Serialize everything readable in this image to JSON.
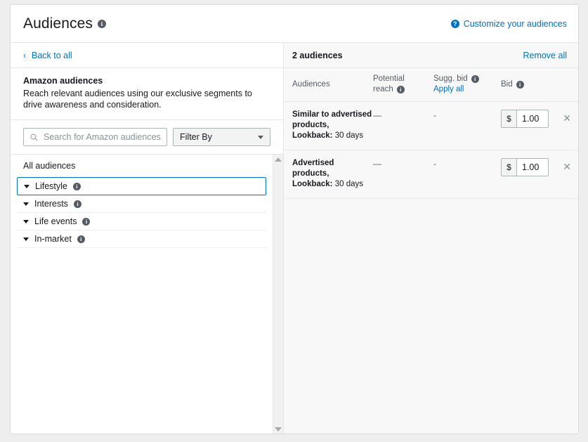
{
  "header": {
    "title": "Audiences",
    "title_info_icon": "info-icon",
    "customize_link": "Customize your audiences",
    "customize_icon": "question-circle-icon"
  },
  "left_panel": {
    "back_link": "Back to all",
    "back_icon": "chevron-left-icon",
    "description_title": "Amazon audiences",
    "description_text": "Reach relevant audiences using our exclusive segments to drive awareness and consideration.",
    "search": {
      "placeholder": "Search for Amazon audiences",
      "value": "",
      "icon": "search-icon"
    },
    "filter": {
      "label": "Filter By",
      "icon": "chevron-down-icon"
    },
    "list_heading": "All audiences",
    "categories": [
      {
        "label": "Lifestyle",
        "selected": true
      },
      {
        "label": "Interests",
        "selected": false
      },
      {
        "label": "Life events",
        "selected": false
      },
      {
        "label": "In-market",
        "selected": false
      }
    ],
    "scrollbar": {
      "up_icon": "scroll-up-arrow-icon",
      "down_icon": "scroll-down-arrow-icon"
    }
  },
  "right_panel": {
    "count_label": "2 audiences",
    "remove_all": "Remove all",
    "columns": {
      "audiences": "Audiences",
      "potential_reach": "Potential reach",
      "sugg_bid": "Sugg. bid",
      "apply_all": "Apply all",
      "bid": "Bid"
    },
    "rows": [
      {
        "name": "Similar to advertised products,",
        "lookback_label": "Lookback:",
        "lookback_value": "30 days",
        "potential_reach": "—",
        "sugg_bid": "-",
        "bid_currency": "$",
        "bid_value": "1.00",
        "remove_icon": "close-icon"
      },
      {
        "name": "Advertised products,",
        "lookback_label": "Lookback:",
        "lookback_value": "30 days",
        "potential_reach": "—",
        "sugg_bid": "-",
        "bid_currency": "$",
        "bid_value": "1.00",
        "remove_icon": "close-icon"
      }
    ]
  },
  "colors": {
    "link": "#0073bb",
    "text": "#16191f",
    "muted": "#545b64",
    "border": "#d5dbdb",
    "panel_bg": "#f8f8f8",
    "page_bg": "#eeeeee"
  }
}
